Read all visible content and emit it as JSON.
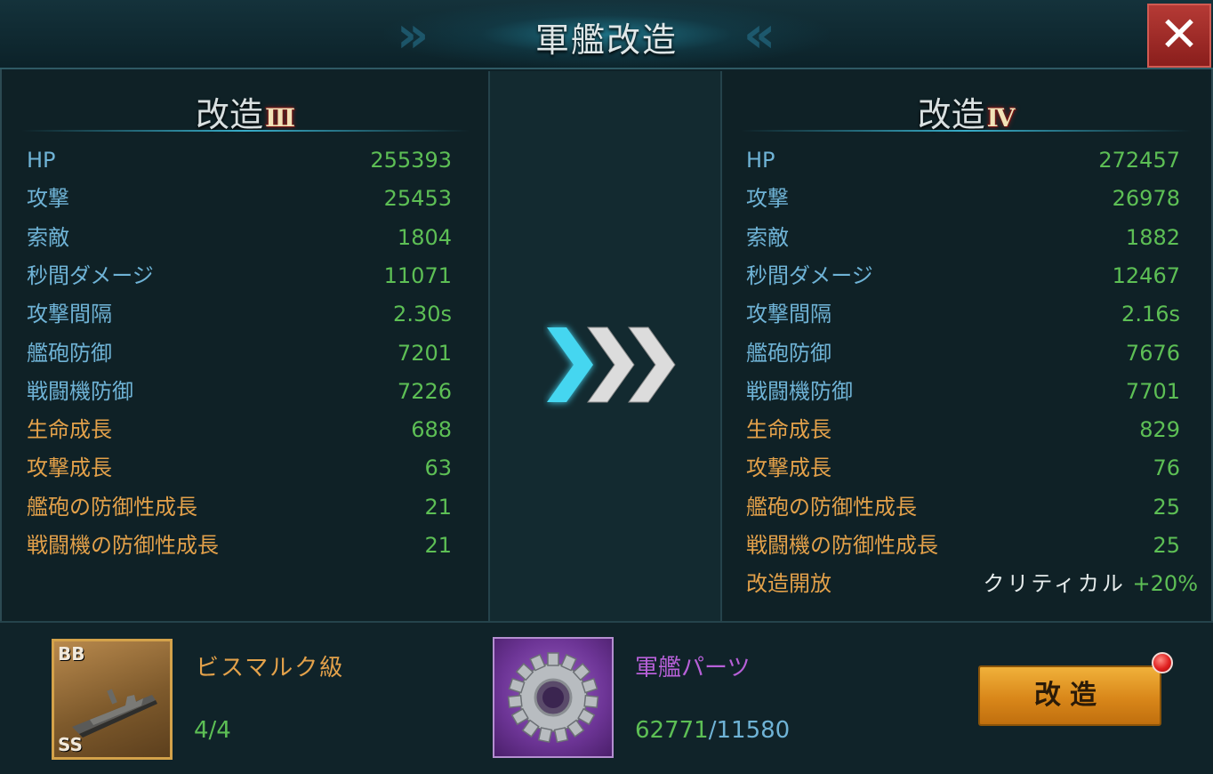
{
  "header": {
    "title": "軍艦改造",
    "close_label": "✕"
  },
  "current": {
    "title": "改造",
    "rank": "Ⅲ",
    "stats": [
      {
        "label": "HP",
        "value": "255393",
        "color": "blue"
      },
      {
        "label": "攻撃",
        "value": "25453",
        "color": "blue"
      },
      {
        "label": "索敵",
        "value": "1804",
        "color": "blue"
      },
      {
        "label": "秒間ダメージ",
        "value": "11071",
        "color": "blue"
      },
      {
        "label": "攻撃間隔",
        "value": "2.30s",
        "color": "blue"
      },
      {
        "label": "艦砲防御",
        "value": "7201",
        "color": "blue"
      },
      {
        "label": "戦闘機防御",
        "value": "7226",
        "color": "blue"
      },
      {
        "label": "生命成長",
        "value": "688",
        "color": "orange"
      },
      {
        "label": "攻撃成長",
        "value": "63",
        "color": "orange"
      },
      {
        "label": "艦砲の防御性成長",
        "value": "21",
        "color": "orange"
      },
      {
        "label": "戦闘機の防御性成長",
        "value": "21",
        "color": "orange"
      }
    ]
  },
  "next": {
    "title": "改造",
    "rank": "Ⅳ",
    "stats": [
      {
        "label": "HP",
        "value": "272457",
        "color": "blue"
      },
      {
        "label": "攻撃",
        "value": "26978",
        "color": "blue"
      },
      {
        "label": "索敵",
        "value": "1882",
        "color": "blue"
      },
      {
        "label": "秒間ダメージ",
        "value": "12467",
        "color": "blue"
      },
      {
        "label": "攻撃間隔",
        "value": "2.16s",
        "color": "blue"
      },
      {
        "label": "艦砲防御",
        "value": "7676",
        "color": "blue"
      },
      {
        "label": "戦闘機防御",
        "value": "7701",
        "color": "blue"
      },
      {
        "label": "生命成長",
        "value": "829",
        "color": "orange"
      },
      {
        "label": "攻撃成長",
        "value": "76",
        "color": "orange"
      },
      {
        "label": "艦砲の防御性成長",
        "value": "25",
        "color": "orange"
      },
      {
        "label": "戦闘機の防御性成長",
        "value": "25",
        "color": "orange"
      }
    ],
    "unlock": {
      "label": "改造開放",
      "text": "クリティカル",
      "value": "+20%"
    }
  },
  "requirements": {
    "ship": {
      "type_tag": "BB",
      "rarity_tag": "SS",
      "name": "ビスマルク級",
      "count": "4/4",
      "icon": "battleship-icon"
    },
    "part": {
      "name": "軍艦パーツ",
      "have": "62771",
      "need": "/11580",
      "icon": "gear-icon"
    }
  },
  "upgrade_button": {
    "label": "改造"
  },
  "colors": {
    "stat_blue": "#6fb3d6",
    "stat_orange": "#e3a14a",
    "value_green": "#5dbf55",
    "part_purple": "#b760d8",
    "button_orange": "#e59a24",
    "close_red": "#a52b28"
  }
}
